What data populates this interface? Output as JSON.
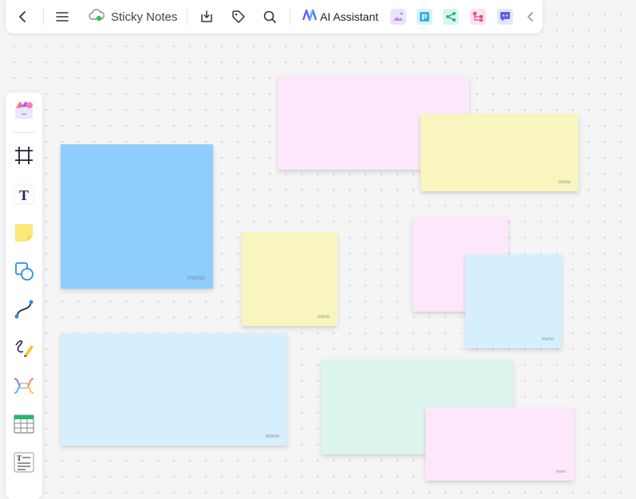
{
  "header": {
    "title": "Sticky Notes",
    "ai_label": "AI Assistant",
    "icons": [
      "back-icon",
      "menu-icon",
      "cloud-icon",
      "download-icon",
      "tag-icon",
      "search-icon",
      "ai-logo-icon",
      "image-ai-icon",
      "p-plugin-icon",
      "mindmap-icon",
      "flowchart-icon",
      "chat-icon",
      "collapse-icon"
    ]
  },
  "sidebar": {
    "tools": [
      "templates",
      "frame",
      "text",
      "sticky-note",
      "shape",
      "connector",
      "pen",
      "mindmap",
      "table",
      "text-block"
    ]
  },
  "notes": [
    {
      "color": "#fde8fb",
      "text": ""
    },
    {
      "color": "#f8f6be",
      "text": "mono"
    },
    {
      "color": "#8ecdfc",
      "text": "mono"
    },
    {
      "color": "#f8f6be",
      "text": "mono"
    },
    {
      "color": "#fde8fb",
      "text": ""
    },
    {
      "color": "#d6effd",
      "text": "mono"
    },
    {
      "color": "#d6effd",
      "text": "mono"
    },
    {
      "color": "#dcf6ee",
      "text": ""
    },
    {
      "color": "#fde8fb",
      "text": "mono"
    }
  ],
  "colors": {
    "accent": "#6b5cff",
    "canvas": "#f5f5f6"
  }
}
